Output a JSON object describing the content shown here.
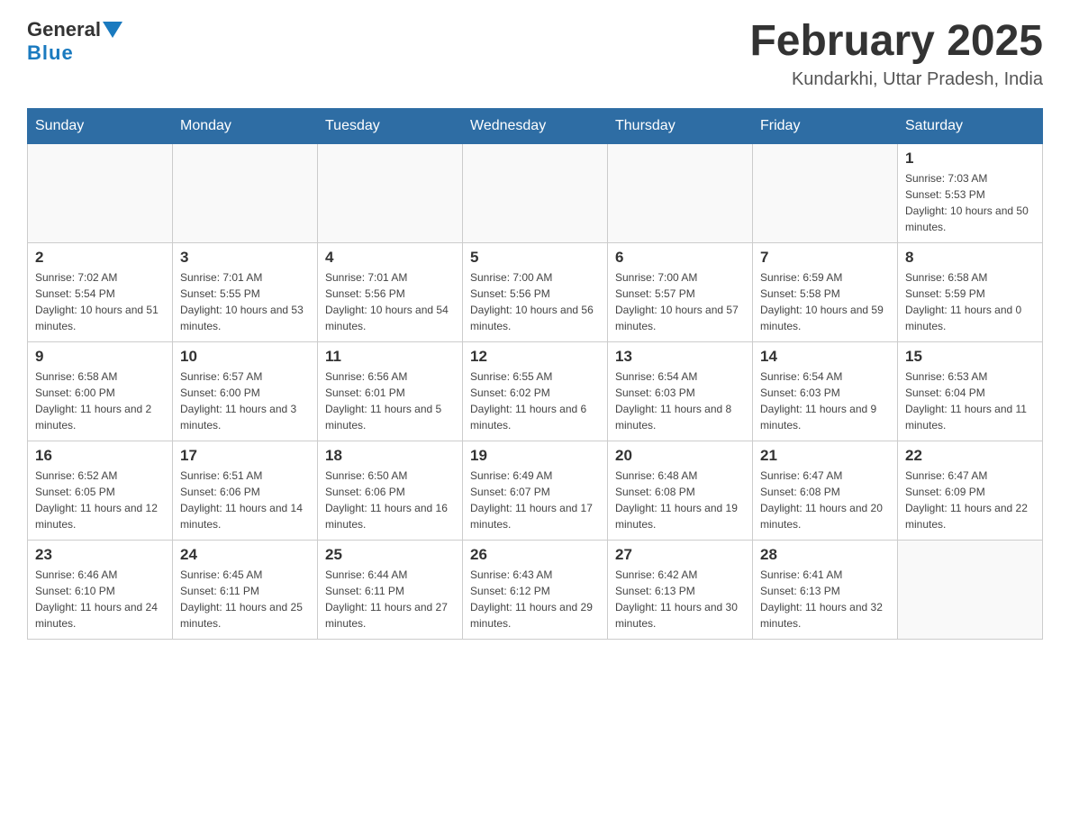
{
  "header": {
    "logo": {
      "general": "General",
      "blue": "Blue"
    },
    "title": "February 2025",
    "subtitle": "Kundarkhi, Uttar Pradesh, India"
  },
  "days_of_week": [
    "Sunday",
    "Monday",
    "Tuesday",
    "Wednesday",
    "Thursday",
    "Friday",
    "Saturday"
  ],
  "weeks": [
    [
      {
        "day": "",
        "info": ""
      },
      {
        "day": "",
        "info": ""
      },
      {
        "day": "",
        "info": ""
      },
      {
        "day": "",
        "info": ""
      },
      {
        "day": "",
        "info": ""
      },
      {
        "day": "",
        "info": ""
      },
      {
        "day": "1",
        "info": "Sunrise: 7:03 AM\nSunset: 5:53 PM\nDaylight: 10 hours and 50 minutes."
      }
    ],
    [
      {
        "day": "2",
        "info": "Sunrise: 7:02 AM\nSunset: 5:54 PM\nDaylight: 10 hours and 51 minutes."
      },
      {
        "day": "3",
        "info": "Sunrise: 7:01 AM\nSunset: 5:55 PM\nDaylight: 10 hours and 53 minutes."
      },
      {
        "day": "4",
        "info": "Sunrise: 7:01 AM\nSunset: 5:56 PM\nDaylight: 10 hours and 54 minutes."
      },
      {
        "day": "5",
        "info": "Sunrise: 7:00 AM\nSunset: 5:56 PM\nDaylight: 10 hours and 56 minutes."
      },
      {
        "day": "6",
        "info": "Sunrise: 7:00 AM\nSunset: 5:57 PM\nDaylight: 10 hours and 57 minutes."
      },
      {
        "day": "7",
        "info": "Sunrise: 6:59 AM\nSunset: 5:58 PM\nDaylight: 10 hours and 59 minutes."
      },
      {
        "day": "8",
        "info": "Sunrise: 6:58 AM\nSunset: 5:59 PM\nDaylight: 11 hours and 0 minutes."
      }
    ],
    [
      {
        "day": "9",
        "info": "Sunrise: 6:58 AM\nSunset: 6:00 PM\nDaylight: 11 hours and 2 minutes."
      },
      {
        "day": "10",
        "info": "Sunrise: 6:57 AM\nSunset: 6:00 PM\nDaylight: 11 hours and 3 minutes."
      },
      {
        "day": "11",
        "info": "Sunrise: 6:56 AM\nSunset: 6:01 PM\nDaylight: 11 hours and 5 minutes."
      },
      {
        "day": "12",
        "info": "Sunrise: 6:55 AM\nSunset: 6:02 PM\nDaylight: 11 hours and 6 minutes."
      },
      {
        "day": "13",
        "info": "Sunrise: 6:54 AM\nSunset: 6:03 PM\nDaylight: 11 hours and 8 minutes."
      },
      {
        "day": "14",
        "info": "Sunrise: 6:54 AM\nSunset: 6:03 PM\nDaylight: 11 hours and 9 minutes."
      },
      {
        "day": "15",
        "info": "Sunrise: 6:53 AM\nSunset: 6:04 PM\nDaylight: 11 hours and 11 minutes."
      }
    ],
    [
      {
        "day": "16",
        "info": "Sunrise: 6:52 AM\nSunset: 6:05 PM\nDaylight: 11 hours and 12 minutes."
      },
      {
        "day": "17",
        "info": "Sunrise: 6:51 AM\nSunset: 6:06 PM\nDaylight: 11 hours and 14 minutes."
      },
      {
        "day": "18",
        "info": "Sunrise: 6:50 AM\nSunset: 6:06 PM\nDaylight: 11 hours and 16 minutes."
      },
      {
        "day": "19",
        "info": "Sunrise: 6:49 AM\nSunset: 6:07 PM\nDaylight: 11 hours and 17 minutes."
      },
      {
        "day": "20",
        "info": "Sunrise: 6:48 AM\nSunset: 6:08 PM\nDaylight: 11 hours and 19 minutes."
      },
      {
        "day": "21",
        "info": "Sunrise: 6:47 AM\nSunset: 6:08 PM\nDaylight: 11 hours and 20 minutes."
      },
      {
        "day": "22",
        "info": "Sunrise: 6:47 AM\nSunset: 6:09 PM\nDaylight: 11 hours and 22 minutes."
      }
    ],
    [
      {
        "day": "23",
        "info": "Sunrise: 6:46 AM\nSunset: 6:10 PM\nDaylight: 11 hours and 24 minutes."
      },
      {
        "day": "24",
        "info": "Sunrise: 6:45 AM\nSunset: 6:11 PM\nDaylight: 11 hours and 25 minutes."
      },
      {
        "day": "25",
        "info": "Sunrise: 6:44 AM\nSunset: 6:11 PM\nDaylight: 11 hours and 27 minutes."
      },
      {
        "day": "26",
        "info": "Sunrise: 6:43 AM\nSunset: 6:12 PM\nDaylight: 11 hours and 29 minutes."
      },
      {
        "day": "27",
        "info": "Sunrise: 6:42 AM\nSunset: 6:13 PM\nDaylight: 11 hours and 30 minutes."
      },
      {
        "day": "28",
        "info": "Sunrise: 6:41 AM\nSunset: 6:13 PM\nDaylight: 11 hours and 32 minutes."
      },
      {
        "day": "",
        "info": ""
      }
    ]
  ]
}
